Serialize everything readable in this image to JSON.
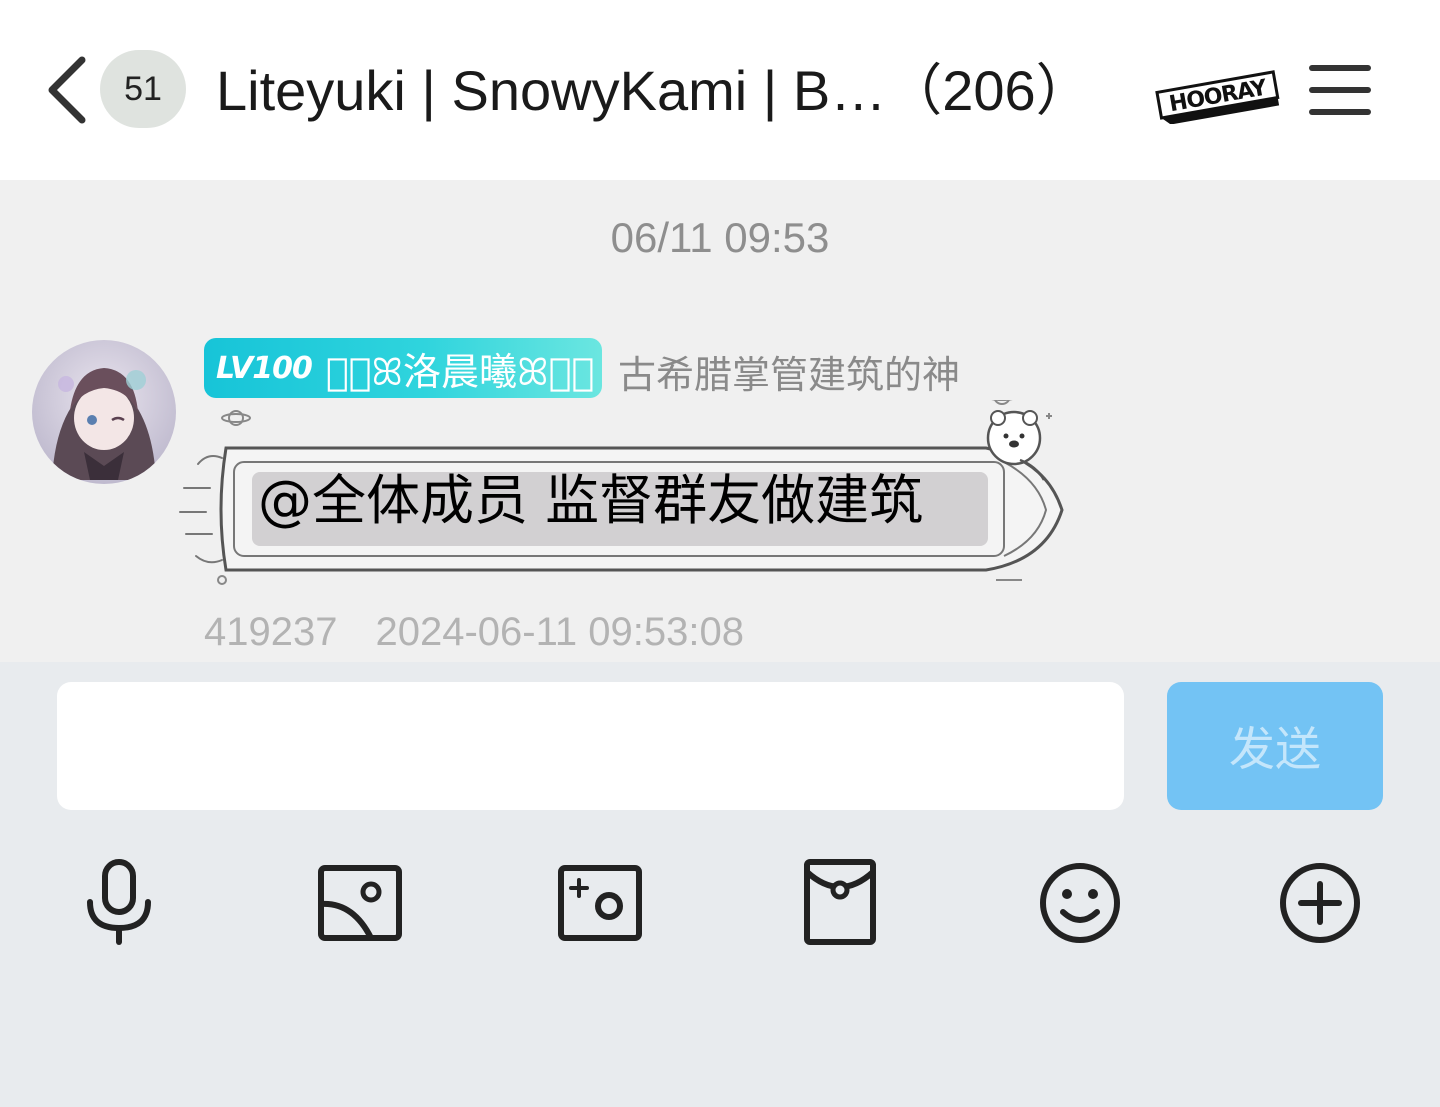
{
  "header": {
    "unread_count": "51",
    "title": "Liteyuki | SnowyKami | B…（206）",
    "icons": {
      "back": "chevron-left-icon",
      "menu": "hamburger-menu-icon",
      "badge": "hooray-logo"
    }
  },
  "chat": {
    "time_divider": "06/11 09:53",
    "message": {
      "level": "LV100",
      "nickname": "ᯓ⃒ꕤ洛晨曦ꕤᯓ⃒",
      "member_title": "古希腊掌管建筑的神",
      "text": "@全体成员 监督群友做建筑",
      "sender_id": "419237",
      "timestamp": "2024-06-11 09:53:08"
    }
  },
  "composer": {
    "input_value": "",
    "send_label": "发送",
    "toolbar": [
      "microphone-icon",
      "image-icon",
      "camera-icon",
      "red-packet-icon",
      "emoji-icon",
      "plus-icon"
    ]
  },
  "colors": {
    "chat_bg": "#f0f0f0",
    "panel_bg": "#e8ebee",
    "send_button": "#73c3f4",
    "level_badge": "#17c4d8"
  }
}
